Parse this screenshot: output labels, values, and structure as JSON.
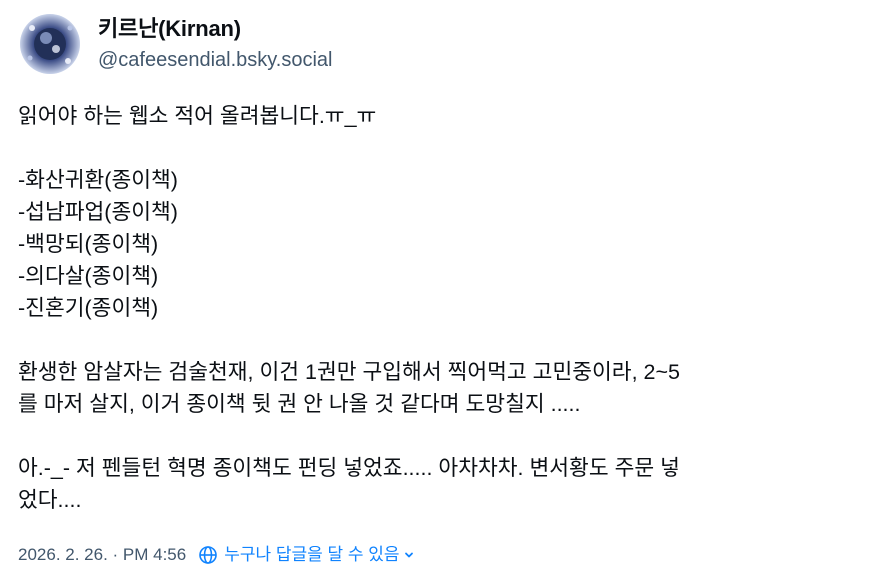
{
  "author": {
    "display_name": "키르난(Kirnan)",
    "handle": "@cafeesendial.bsky.social",
    "avatar_icon": "avatar-image"
  },
  "post": {
    "line1": "읽어야 하는 웹소 적어 올려봅니다.ㅠ_ㅠ",
    "list": [
      "-화산귀환(종이책)",
      "-섭남파업(종이책)",
      "-백망되(종이책)",
      "-의다살(종이책)",
      "-진혼기(종이책)"
    ],
    "para1": "환생한 암살자는 검술천재, 이건 1권만 구입해서 찍어먹고 고민중이라, 2~5\n를 마저 살지, 이거 종이책 뒷 권 안 나올 것 같다며 도망칠지 .....",
    "para2": "아.-_- 저 펜들턴 혁명 종이책도 펀딩 넣었죠..... 아차차차. 변서황도 주문 넣\n었다...."
  },
  "footer": {
    "timestamp": "2026. 2. 26. · PM 4:56",
    "reply_setting": "누구나 답글을 달 수 있음",
    "globe_icon": "globe-icon",
    "chevron_icon": "chevron-down-icon",
    "accent_color": "#1083fe"
  }
}
